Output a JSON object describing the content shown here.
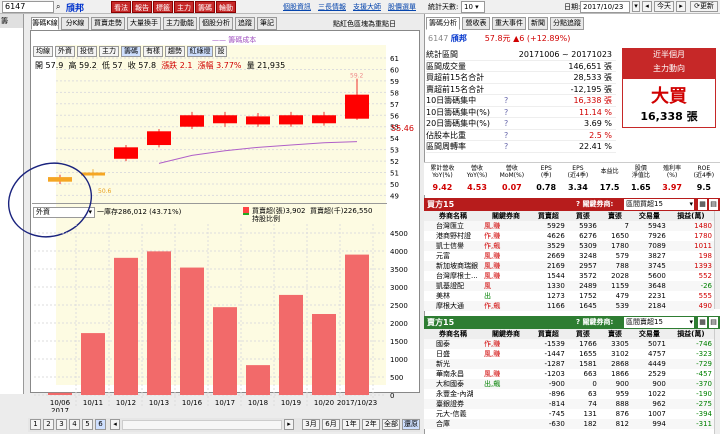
{
  "toolbar": {
    "code": "6147",
    "name": "頎邦",
    "buttons": [
      "看法",
      "報告",
      "標籤",
      "主力",
      "籌碼",
      "輪動"
    ],
    "links": [
      "個股資訊",
      "三長情報",
      "支援大師",
      "股價選單"
    ],
    "right_label": "統計天數:",
    "days": "10",
    "date_label": "日期:",
    "date": "2017/10/23",
    "today": "今天",
    "update": "更新"
  },
  "left_tabs": [
    "籌碼K線",
    "分K線",
    "買賣走勢",
    "大量換手",
    "主力動能",
    "個股分析",
    "追蹤",
    "筆記"
  ],
  "right_note": "點紅色區塊為重點日",
  "chart_tabs": [
    "均線",
    "外資",
    "投信",
    "主力",
    "籌碼",
    "有樣",
    "趨勢",
    "紅綠燈",
    "設"
  ],
  "ohlc": {
    "open_label": "開",
    "open": "57.9",
    "high_label": "高",
    "high": "59.2",
    "low_label": "低",
    "low": "57",
    "close_label": "收",
    "close": "57.8",
    "chg_label": "漲跌",
    "chg": "2.1",
    "pct_label": "漲幅",
    "pct": "3.77%",
    "vol_label": "量",
    "vol": "21,935"
  },
  "ma_legend": "籌碼成本",
  "chart_data": [
    {
      "type": "candlestick",
      "dates": [
        "10/06",
        "10/11",
        "10/12",
        "10/13",
        "10/16",
        "10/17",
        "10/18",
        "10/19",
        "10/20",
        "10/23"
      ],
      "open": [
        50.2,
        51.0,
        52.2,
        53.4,
        55.0,
        55.3,
        55.2,
        55.2,
        55.3,
        55.7
      ],
      "close": [
        50.6,
        50.8,
        53.2,
        54.6,
        56.0,
        56.0,
        55.9,
        56.0,
        56.0,
        57.8
      ],
      "high": [
        50.8,
        51.3,
        53.4,
        54.8,
        56.3,
        56.3,
        56.2,
        56.3,
        56.3,
        59.2
      ],
      "low": [
        50.0,
        50.5,
        52.0,
        53.2,
        54.8,
        55.0,
        55.0,
        55.0,
        55.1,
        55.6
      ],
      "ylim": [
        48.6,
        61
      ],
      "ticks": [
        49,
        50,
        51,
        52,
        53,
        54,
        55,
        56,
        57,
        58,
        59,
        60,
        61
      ],
      "labels": {
        "price_high": "59.2",
        "price_now": "55.46",
        "price_low": "50.6"
      },
      "ma": [
        50.6,
        50.7,
        51.1,
        51.8,
        52.5,
        52.9,
        53.2,
        53.4,
        53.6,
        53.7
      ]
    },
    {
      "type": "bar",
      "categories": [
        "10/06",
        "10/11",
        "10/12",
        "10/13",
        "10/16",
        "10/17",
        "10/18",
        "10/19",
        "10/20",
        "10/23"
      ],
      "values": [
        60,
        1720,
        3810,
        3990,
        3540,
        2440,
        830,
        2780,
        2250,
        3900
      ],
      "ylim": [
        0,
        4750
      ],
      "ticks": [
        0,
        500,
        1000,
        1500,
        2000,
        2500,
        3000,
        3500,
        4000,
        4500
      ],
      "year": "2017",
      "last_date": "2017/10/23"
    }
  ],
  "lower_panel": {
    "select": "外資",
    "total_label": "一庫存286,012 (43.71%)",
    "buy_label": "買賣超(張)3,902",
    "sum_label": "買賣超(千)226,550",
    "hold_label": "持股比例"
  },
  "nav": {
    "pages": [
      "1",
      "2",
      "3",
      "4",
      "5",
      "6"
    ],
    "ranges": [
      "3月",
      "6月",
      "1年",
      "2年",
      "全部",
      "還原"
    ]
  },
  "right_tabs": [
    "籌碼分析",
    "營收表",
    "重大事件",
    "新聞",
    "分點追蹤"
  ],
  "stock_line": {
    "code": "6147",
    "name": "頎邦",
    "price": "57.8元",
    "chg": "▲6 (+12.89%)"
  },
  "summary": {
    "rows": [
      {
        "k": "統計區間",
        "v": "20171006 ~ 20171023"
      },
      {
        "k": "區間成交量",
        "v": "146,651 張"
      },
      {
        "k": "買超前15名合計",
        "v": "28,533 張"
      },
      {
        "k": "賣超前15名合計",
        "v": "-12,195 張"
      },
      {
        "k": "10日籌碼集中",
        "v": "16,338 張"
      },
      {
        "k": "10日籌碼集中(%)",
        "v": "11.14 %"
      },
      {
        "k": "20日籌碼集中(%)",
        "v": "3.69 %"
      },
      {
        "k": "佔股本比重",
        "v": "2.5 %"
      },
      {
        "k": "區間周轉率",
        "v": "22.41 %"
      }
    ],
    "box_title1": "近半個月",
    "box_title2": "主力動向",
    "big": "大買",
    "amount": "16,338 張"
  },
  "stats": {
    "headers": [
      "累計營收\nYoY(%)",
      "營收\nYoY(%)",
      "營收\nMoM(%)",
      "EPS\n(季)",
      "EPS\n(近4季)",
      "本益比",
      "股價\n淨值比",
      "殖利率\n(%)",
      "ROE\n(近4季)"
    ],
    "values": [
      "9.42",
      "4.53",
      "0.07",
      "0.78",
      "3.34",
      "17.5",
      "1.65",
      "3.97",
      "9.5"
    ]
  },
  "buy_table": {
    "title": "買方15",
    "filter_label": "關鍵券商:",
    "filter": "區間買超15",
    "cols": [
      "券商名稱",
      "關鍵券商",
      "買賣超",
      "買張",
      "賣張",
      "交易量",
      "損益(萬)"
    ],
    "rows": [
      [
        "台灣匯立",
        "風,賺",
        "5929",
        "5936",
        "7",
        "5943",
        "1480"
      ],
      [
        "港商野村證",
        "作,賺",
        "4626",
        "6276",
        "1650",
        "7926",
        "1780"
      ],
      [
        "凱士信譽",
        "作,飆",
        "3529",
        "5309",
        "1780",
        "7089",
        "1011"
      ],
      [
        "元富",
        "風,賺",
        "2669",
        "3248",
        "579",
        "3827",
        "198"
      ],
      [
        "新加坡商瑞銀",
        "風,賺",
        "2169",
        "2957",
        "788",
        "3745",
        "1393"
      ],
      [
        "台灣摩根士...",
        "風,賺",
        "1544",
        "3572",
        "2028",
        "5600",
        "552"
      ],
      [
        "凱基證配",
        "風",
        "1330",
        "2489",
        "1159",
        "3648",
        "-26"
      ],
      [
        "美林",
        "出",
        "1273",
        "1752",
        "479",
        "2231",
        "555"
      ],
      [
        "摩根大通",
        "作,飆",
        "1166",
        "1645",
        "539",
        "2184",
        "490"
      ]
    ]
  },
  "sell_table": {
    "title": "賣方15",
    "filter_label": "關鍵券商:",
    "filter": "區間賣超15",
    "cols": [
      "券商名稱",
      "關鍵券商",
      "買賣超",
      "買張",
      "賣張",
      "交易量",
      "損益(萬)"
    ],
    "rows": [
      [
        "國泰",
        "作,賺",
        "-1539",
        "1766",
        "3305",
        "5071",
        "-746"
      ],
      [
        "日盛",
        "風,賺",
        "-1447",
        "1655",
        "3102",
        "4757",
        "-323"
      ],
      [
        "新光",
        "",
        "-1287",
        "1581",
        "2868",
        "4449",
        "-729"
      ],
      [
        "華南永昌",
        "風,賺",
        "-1203",
        "663",
        "1866",
        "2529",
        "-457"
      ],
      [
        "大和國泰",
        "出,飆",
        "-900",
        "0",
        "900",
        "900",
        "-370"
      ],
      [
        "永豐金-內湖",
        "",
        "-896",
        "63",
        "959",
        "1022",
        "-190"
      ],
      [
        "臺銀證券",
        "",
        "-814",
        "74",
        "888",
        "962",
        "-275"
      ],
      [
        "元大-信義",
        "",
        "-745",
        "131",
        "876",
        "1007",
        "-394"
      ],
      [
        "合庫",
        "",
        "-630",
        "182",
        "812",
        "994",
        "-311"
      ]
    ]
  }
}
